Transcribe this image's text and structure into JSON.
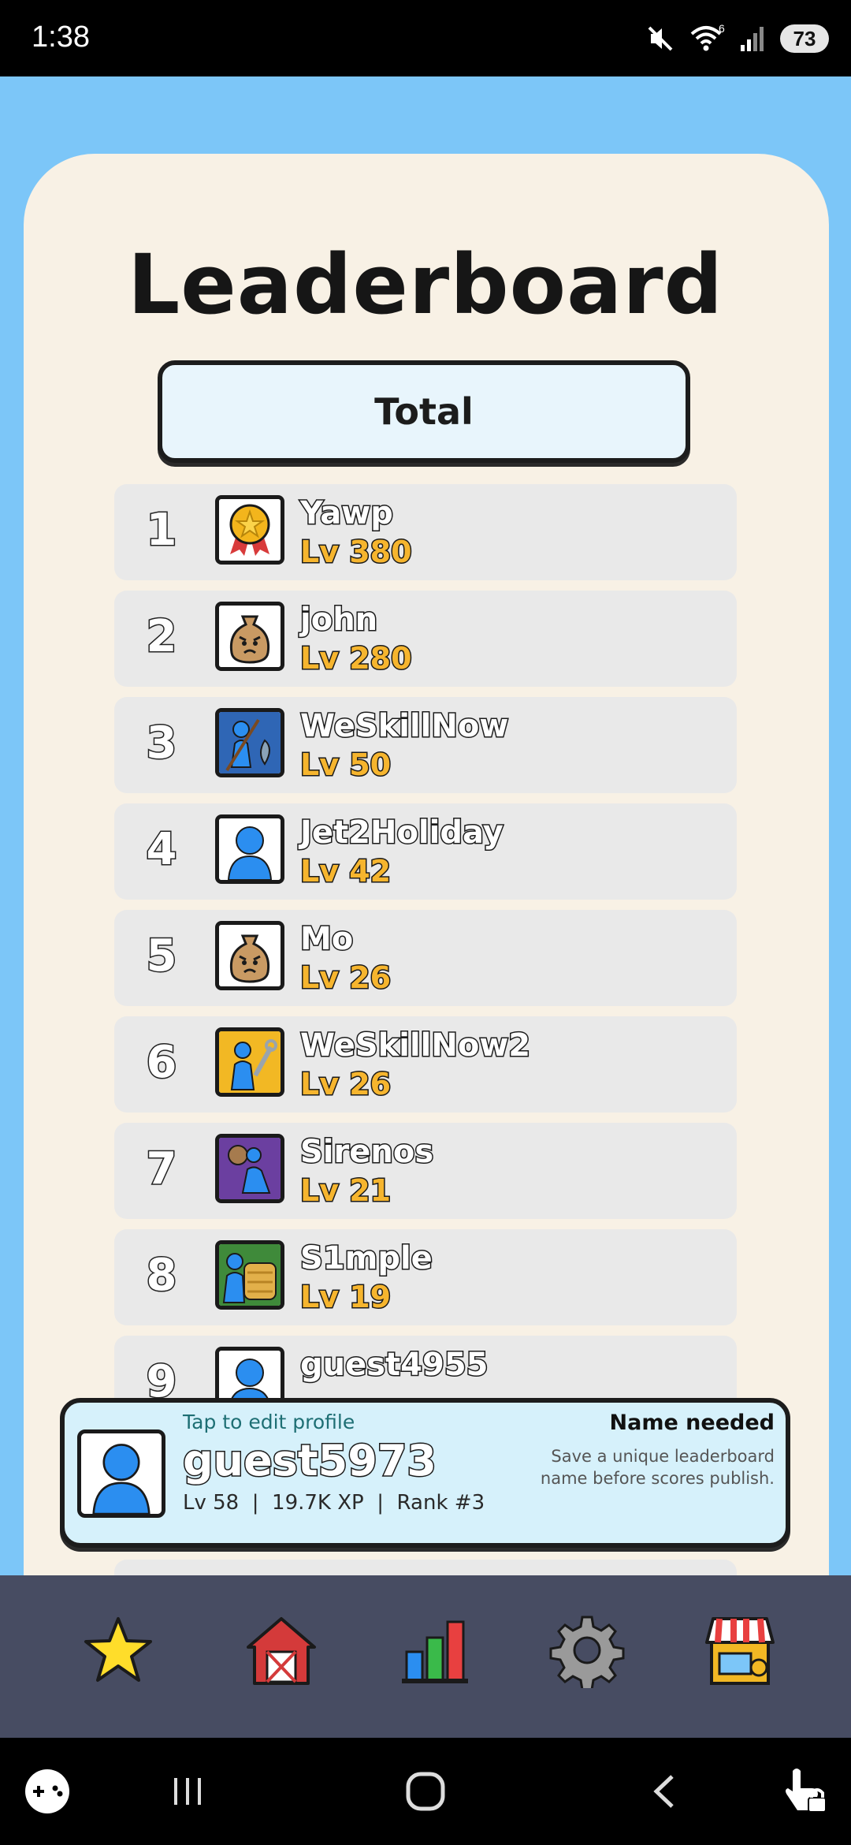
{
  "status_bar": {
    "time": "1:38",
    "wifi_badge": "6",
    "battery": "73",
    "icons": [
      "mute-icon",
      "wifi-icon",
      "signal-icon",
      "battery-icon"
    ]
  },
  "header": {
    "title": "Leaderboard",
    "filter_label": "Total"
  },
  "leaderboard": [
    {
      "rank": "1",
      "name": "Yawp",
      "level": "Lv 380",
      "avatar": "medal-icon"
    },
    {
      "rank": "2",
      "name": "john",
      "level": "Lv 280",
      "avatar": "angry-sack-icon"
    },
    {
      "rank": "3",
      "name": "WeSkillNow",
      "level": "Lv 50",
      "avatar": "fishing-icon"
    },
    {
      "rank": "4",
      "name": "Jet2Holiday",
      "level": "Lv 42",
      "avatar": "person-icon"
    },
    {
      "rank": "5",
      "name": "Mo",
      "level": "Lv 26",
      "avatar": "angry-sack-icon"
    },
    {
      "rank": "6",
      "name": "WeSkillNow2",
      "level": "Lv 26",
      "avatar": "wrench-worker-icon"
    },
    {
      "rank": "7",
      "name": "Sirenos",
      "level": "Lv 21",
      "avatar": "runner-icon"
    },
    {
      "rank": "8",
      "name": "S1mple",
      "level": "Lv 19",
      "avatar": "hay-bale-icon"
    },
    {
      "rank": "9",
      "name": "guest4955",
      "level": "",
      "avatar": "person-icon"
    }
  ],
  "profile": {
    "hint": "Tap to edit profile",
    "name": "guest5973",
    "stats": "Lv 58  |  19.7K XP  |  Rank #3",
    "status_title": "Name needed",
    "status_note": "Save a unique leaderboard name before scores publish."
  },
  "bottom_nav": [
    {
      "icon": "star-icon"
    },
    {
      "icon": "barn-icon"
    },
    {
      "icon": "bar-chart-icon"
    },
    {
      "icon": "settings-gear-icon"
    },
    {
      "icon": "shop-icon"
    }
  ],
  "system_nav": [
    "game-controller-icon",
    "recent-apps-icon",
    "home-icon",
    "back-icon",
    "touch-lock-icon"
  ],
  "colors": {
    "background": "#7cc6f8",
    "card": "#f8f1e5",
    "row": "#e9e9e9",
    "level_gold": "#f6b52e",
    "nav_bar": "#474c62",
    "profile_panel": "#d6f1fb"
  }
}
